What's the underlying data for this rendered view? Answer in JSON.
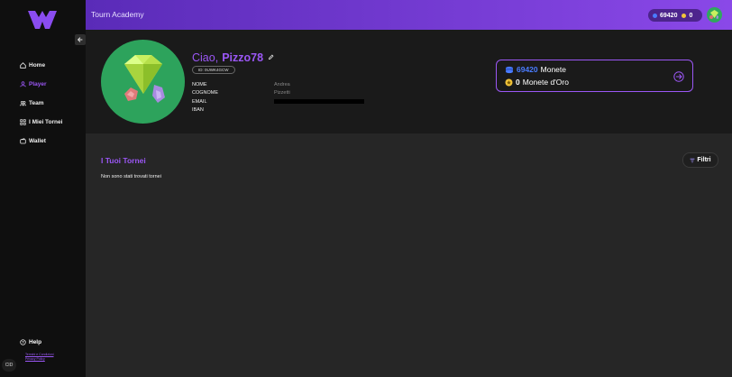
{
  "app": {
    "title": "Tourn Academy"
  },
  "header": {
    "coins": "69420",
    "gold": "0",
    "colors": {
      "accent": "#9b57f5",
      "coin": "#4a7cff",
      "gold": "#f2c43a"
    }
  },
  "sidebar": {
    "collapse_icon": "arrow-left-icon",
    "items": [
      {
        "label": "Home",
        "icon": "home-icon"
      },
      {
        "label": "Player",
        "icon": "user-icon",
        "active": true
      },
      {
        "label": "Team",
        "icon": "team-icon"
      },
      {
        "label": "I Miei Tornei",
        "icon": "grid-icon"
      },
      {
        "label": "Wallet",
        "icon": "wallet-icon"
      }
    ],
    "help": "Help",
    "legal": [
      "Termini e Condizioni",
      "Privacy Policy"
    ],
    "lang": "CID"
  },
  "profile": {
    "greeting": "Ciao,",
    "username": "Pizzo78",
    "id": "ID: 0UWK4GCW",
    "fields": [
      {
        "label": "NOME",
        "value": "Andrea"
      },
      {
        "label": "COGNOME",
        "value": "Pizzetti"
      },
      {
        "label": "EMAIL",
        "value": ""
      },
      {
        "label": "IBAN",
        "value": ""
      }
    ]
  },
  "wallet": {
    "coins_amount": "69420",
    "coins_label": "Monete",
    "gold_amount": "0",
    "gold_label": "Monete d'Oro"
  },
  "main": {
    "title": "I Tuoi Tornei",
    "empty_text": "Non sono stati trovati tornei",
    "filter_label": "Filtri"
  }
}
